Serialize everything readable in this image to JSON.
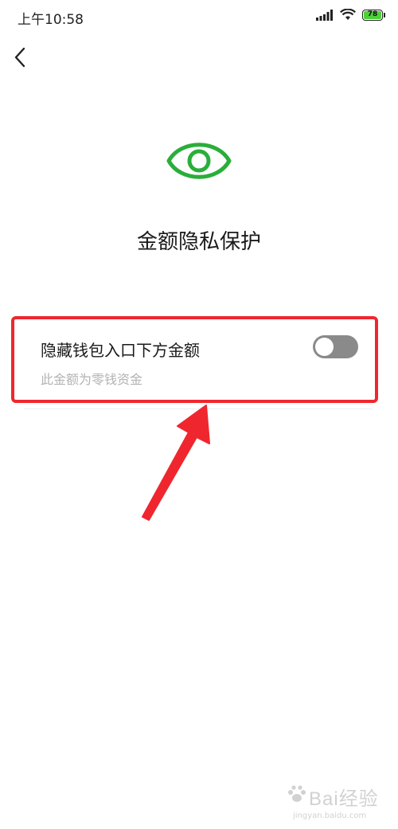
{
  "status_bar": {
    "time": "上午10:58",
    "battery_level": "78",
    "battery_color": "#4cd137"
  },
  "nav": {
    "back_icon": "chevron-left-icon"
  },
  "header": {
    "icon": "eye-icon",
    "icon_color": "#2aae3a",
    "title": "金额隐私保护"
  },
  "setting": {
    "label": "隐藏钱包入口下方金额",
    "description": "此金额为零钱资金",
    "toggle_on": false
  },
  "annotation": {
    "highlight_color": "#f0262e"
  },
  "watermark": {
    "brand": "Bai经验",
    "url": "jingyan.baidu.com"
  }
}
